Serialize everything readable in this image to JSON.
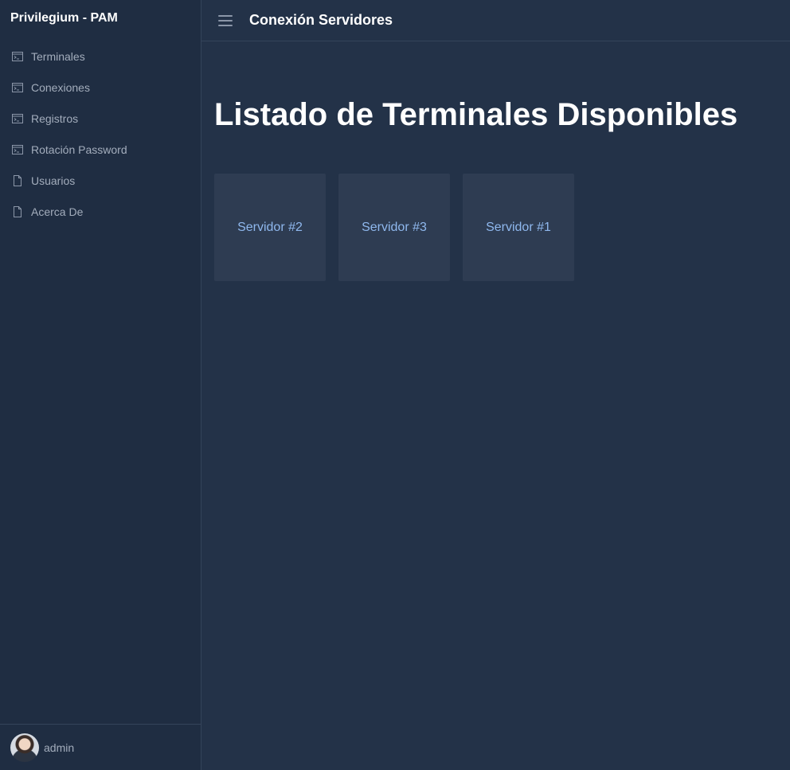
{
  "sidebar": {
    "brand": "Privilegium - PAM",
    "items": [
      {
        "label": "Terminales",
        "icon": "terminal-icon"
      },
      {
        "label": "Conexiones",
        "icon": "terminal-icon"
      },
      {
        "label": "Registros",
        "icon": "terminal-icon"
      },
      {
        "label": "Rotación Password",
        "icon": "terminal-icon"
      },
      {
        "label": "Usuarios",
        "icon": "document-icon"
      },
      {
        "label": "Acerca De",
        "icon": "document-icon"
      }
    ],
    "user": {
      "name": "admin"
    }
  },
  "header": {
    "title": "Conexión Servidores",
    "menu_icon": "hamburger-menu-icon"
  },
  "main": {
    "heading": "Listado de Terminales Disponibles",
    "servers": [
      {
        "label": "Servidor #2"
      },
      {
        "label": "Servidor #3"
      },
      {
        "label": "Servidor #1"
      }
    ]
  },
  "colors": {
    "background": "#233248",
    "sidebar": "#1f2d42",
    "card": "#2e3c52",
    "card_text": "#8fb8ee",
    "nav_text": "#a3adbc"
  }
}
